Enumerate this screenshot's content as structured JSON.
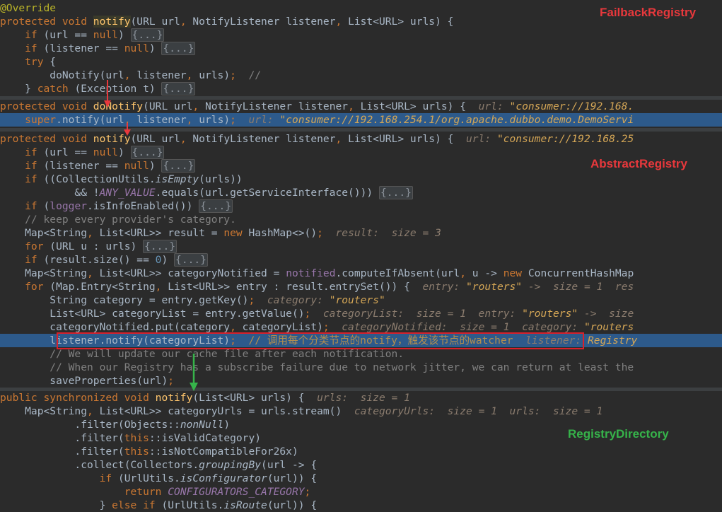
{
  "panels": {
    "failback": {
      "label": "FailbackRegistry",
      "label_color": "#e8383c",
      "lines": [
        "@Override",
        "protected void notify(URL url, NotifyListener listener, List<URL> urls) {",
        "    if (url == null) {...}",
        "    if (listener == null) {...}",
        "    try {",
        "        doNotify(url, listener, urls);  //",
        "    } catch (Exception t) {...}"
      ]
    },
    "donotify": {
      "lines": [
        "protected void doNotify(URL url, NotifyListener listener, List<URL> urls) {  url: \"consumer://192.168.",
        "    super.notify(url, listener, urls);  url: \"consumer://192.168.254.1/org.apache.dubbo.demo.DemoServi"
      ]
    },
    "abstract": {
      "label": "AbstractRegistry",
      "label_color": "#e8383c",
      "lines": [
        "protected void notify(URL url, NotifyListener listener, List<URL> urls) {  url: \"consumer://192.168.25",
        "    if (url == null) {...}",
        "    if (listener == null) {...}",
        "    if ((CollectionUtils.isEmpty(urls))",
        "            && !ANY_VALUE.equals(url.getServiceInterface())) {...}",
        "    if (logger.isInfoEnabled()) {...}",
        "    // keep every provider's category.",
        "    Map<String, List<URL>> result = new HashMap<>();  result:  size = 3",
        "    for (URL u : urls) {...}",
        "    if (result.size() == 0) {...}",
        "    Map<String, List<URL>> categoryNotified = notified.computeIfAbsent(url, u -> new ConcurrentHashMap",
        "    for (Map.Entry<String, List<URL>> entry : result.entrySet()) {  entry: \"routers\" ->  size = 1  res",
        "        String category = entry.getKey();  category: \"routers\"",
        "        List<URL> categoryList = entry.getValue();  categoryList:  size = 1  entry: \"routers\" ->  size",
        "        categoryNotified.put(category, categoryList);  categoryNotified:  size = 1  category: \"routers",
        "        listener.notify(categoryList);  // 调用每个分类节点的notify，触发该节点的watcher  listener: Registry",
        "        // We will update our cache file after each notification.",
        "        // When our Registry has a subscribe failure due to network jitter, we can return at least the",
        "        saveProperties(url);"
      ]
    },
    "directory": {
      "label": "RegistryDirectory",
      "label_color": "#36b34a",
      "lines": [
        "public synchronized void notify(List<URL> urls) {  urls:  size = 1",
        "    Map<String, List<URL>> categoryUrls = urls.stream()  categoryUrls:  size = 1  urls:  size = 1",
        "            .filter(Objects::nonNull)",
        "            .filter(this::isValidCategory)",
        "            .filter(this::isNotCompatibleFor26x)",
        "            .collect(Collectors.groupingBy(url -> {",
        "                if (UrlUtils.isConfigurator(url)) {",
        "                    return CONFIGURATORS_CATEGORY;",
        "                } else if (UrlUtils.isRoute(url)) {"
      ]
    }
  },
  "colors": {
    "background": "#2b2b2b",
    "keyword": "#cc7832",
    "method": "#ffc66d",
    "annotation": "#bbb529",
    "comment": "#808080",
    "number": "#6897bb",
    "field": "#9876aa",
    "highlight_line": "#2d5a8b",
    "red_box": "#d8202a",
    "red_arrow": "#e8383c",
    "green_arrow": "#36b34a"
  }
}
